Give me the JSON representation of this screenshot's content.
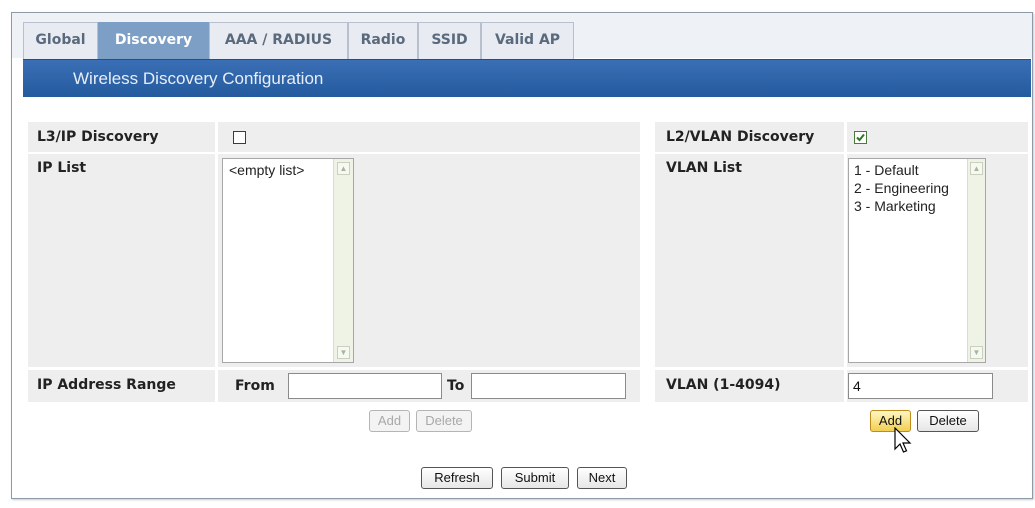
{
  "tabs": [
    {
      "label": "Global",
      "active": false
    },
    {
      "label": "Discovery",
      "active": true
    },
    {
      "label": "AAA / RADIUS",
      "active": false
    },
    {
      "label": "Radio",
      "active": false
    },
    {
      "label": "SSID",
      "active": false
    },
    {
      "label": "Valid AP",
      "active": false
    }
  ],
  "title": "Wireless Discovery Configuration",
  "l3": {
    "label": "L3/IP Discovery",
    "checked": false,
    "ip_list_label": "IP List",
    "ip_list_items": [
      "<empty list>"
    ],
    "range_label": "IP Address Range",
    "from_label": "From",
    "to_label": "To",
    "from_value": "",
    "to_value": "",
    "add_label": "Add",
    "delete_label": "Delete"
  },
  "l2": {
    "label": "L2/VLAN Discovery",
    "checked": true,
    "vlan_list_label": "VLAN List",
    "vlan_list_items": [
      "1 - Default",
      "2 - Engineering",
      "3 - Marketing"
    ],
    "vlan_input_label": "VLAN (1-4094)",
    "vlan_input_value": "4",
    "add_label": "Add",
    "delete_label": "Delete"
  },
  "footer": {
    "refresh_label": "Refresh",
    "submit_label": "Submit",
    "next_label": "Next"
  },
  "colors": {
    "title_bar": "#245a9e",
    "active_tab": "#7d9fc6",
    "row_background": "#eeeeee",
    "add_hover": "#f2cf52"
  }
}
